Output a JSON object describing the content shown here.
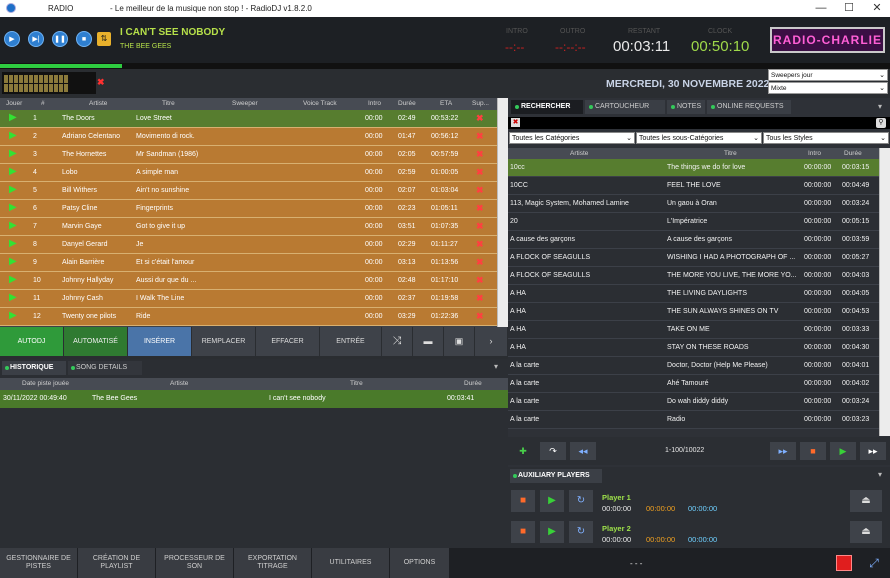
{
  "titlebar": {
    "app": "RADIO",
    "title": "- Le meilleur de la musique non stop ! - RadioDJ v1.8.2.0",
    "minimize": "—",
    "maximize": "☐",
    "close": "✕"
  },
  "nowplaying": {
    "title": "I CAN'T SEE NOBODY",
    "artist": "THE BEE GEES"
  },
  "clocks": {
    "intro_label": "INTRO",
    "intro_value": "--:--",
    "outro_label": "OUTRO",
    "outro_value": "--:--:--",
    "restant_label": "RESTANT",
    "restant_value": "00:03:11",
    "clock_label": "CLOCK",
    "clock_value": "00:50:10"
  },
  "logo": "RADIO-CHARLIE",
  "date": "MERCREDI, 30 NOVEMBRE 2022",
  "sweepers": {
    "value1": "Sweepers jour",
    "value2": "Mixte"
  },
  "playlist": {
    "headers": [
      "Jouer",
      "#",
      "Artiste",
      "Titre",
      "Sweeper",
      "Voice Track",
      "Intro",
      "Durée",
      "ETA",
      "Sup..."
    ],
    "rows": [
      {
        "num": "1",
        "artist": "The Doors",
        "title": "Love Street",
        "intro": "00:00",
        "dur": "02:49",
        "eta": "00:53:22"
      },
      {
        "num": "2",
        "artist": "Adriano Celentano",
        "title": "Movimento di rock.",
        "intro": "00:00",
        "dur": "01:47",
        "eta": "00:56:12"
      },
      {
        "num": "3",
        "artist": "The Hornettes",
        "title": "Mr Sandman (1986)",
        "intro": "00:00",
        "dur": "02:05",
        "eta": "00:57:59"
      },
      {
        "num": "4",
        "artist": "Lobo",
        "title": "A simple man",
        "intro": "00:00",
        "dur": "02:59",
        "eta": "01:00:05"
      },
      {
        "num": "5",
        "artist": "Bill Withers",
        "title": "Ain't no sunshine",
        "intro": "00:00",
        "dur": "02:07",
        "eta": "01:03:04"
      },
      {
        "num": "6",
        "artist": "Patsy Cline",
        "title": "Fingerprints",
        "intro": "00:00",
        "dur": "02:23",
        "eta": "01:05:11"
      },
      {
        "num": "7",
        "artist": "Marvin Gaye",
        "title": "Got to give it up",
        "intro": "00:00",
        "dur": "03:51",
        "eta": "01:07:35"
      },
      {
        "num": "8",
        "artist": "Danyel Gerard",
        "title": "Je",
        "intro": "00:00",
        "dur": "02:29",
        "eta": "01:11:27"
      },
      {
        "num": "9",
        "artist": "Alain Barrière",
        "title": "Et si c'était l'amour",
        "intro": "00:00",
        "dur": "03:13",
        "eta": "01:13:56"
      },
      {
        "num": "10",
        "artist": "Johnny Hallyday",
        "title": "Aussi dur que du ...",
        "intro": "00:00",
        "dur": "02:48",
        "eta": "01:17:10"
      },
      {
        "num": "11",
        "artist": "Johnny Cash",
        "title": "I Walk The Line",
        "intro": "00:00",
        "dur": "02:37",
        "eta": "01:19:58"
      },
      {
        "num": "12",
        "artist": "Twenty one pilots",
        "title": "Ride",
        "intro": "00:00",
        "dur": "03:29",
        "eta": "01:22:36"
      }
    ]
  },
  "toolbar": {
    "autodj": "AUTODJ",
    "automatise": "AUTOMATISÉ",
    "inserer": "INSÉRER",
    "remplacer": "REMPLACER",
    "effacer": "EFFACER",
    "entree": "ENTRÉE"
  },
  "history": {
    "tab1": "HISTORIQUE",
    "tab2": "SONG DETAILS",
    "headers": [
      "Date piste jouée",
      "Artiste",
      "Titre",
      "Durée"
    ],
    "row": {
      "date": "30/11/2022 00:49:40",
      "artist": "The Bee Gees",
      "title": "I can't see nobody",
      "dur": "00:03:41"
    }
  },
  "bottom": [
    "GESTIONNAIRE DE PISTES",
    "CRÉATION DE PLAYLIST",
    "PROCESSEUR DE SON",
    "EXPORTATION TITRAGE",
    "UTILITAIRES",
    "OPTIONS"
  ],
  "bottom_status": "- - -",
  "search": {
    "tabs": [
      "RECHERCHER",
      "CARTOUCHEUR",
      "NOTES",
      "ONLINE REQUESTS"
    ],
    "cat": "Toutes les Catégories",
    "subcat": "Toutes les sous-Catégories",
    "styles": "Tous les Styles",
    "headers": [
      "Artiste",
      "Titre",
      "Intro",
      "Durée"
    ],
    "rows": [
      {
        "artist": "10cc",
        "title": "The things we do for love",
        "intro": "00:00:00",
        "dur": "00:03:15"
      },
      {
        "artist": "10CC",
        "title": "FEEL THE LOVE",
        "intro": "00:00:00",
        "dur": "00:04:49"
      },
      {
        "artist": "113, Magic System, Mohamed Lamine",
        "title": "Un gaou à Oran",
        "intro": "00:00:00",
        "dur": "00:03:24"
      },
      {
        "artist": "20",
        "title": "L'Impératrice",
        "intro": "00:00:00",
        "dur": "00:05:15"
      },
      {
        "artist": "A cause des garçons",
        "title": "A cause des garçons",
        "intro": "00:00:00",
        "dur": "00:03:59"
      },
      {
        "artist": "A FLOCK OF SEAGULLS",
        "title": "WISHING I HAD A PHOTOGRAPH OF ...",
        "intro": "00:00:00",
        "dur": "00:05:27"
      },
      {
        "artist": "A FLOCK OF SEAGULLS",
        "title": "THE MORE YOU LIVE, THE MORE YO...",
        "intro": "00:00:00",
        "dur": "00:04:03"
      },
      {
        "artist": "A HA",
        "title": "THE LIVING DAYLIGHTS",
        "intro": "00:00:00",
        "dur": "00:04:05"
      },
      {
        "artist": "A HA",
        "title": "THE SUN ALWAYS SHINES ON TV",
        "intro": "00:00:00",
        "dur": "00:04:53"
      },
      {
        "artist": "A HA",
        "title": "TAKE ON ME",
        "intro": "00:00:00",
        "dur": "00:03:33"
      },
      {
        "artist": "A HA",
        "title": "STAY ON THESE ROADS",
        "intro": "00:00:00",
        "dur": "00:04:30"
      },
      {
        "artist": "A la carte",
        "title": "Doctor, Doctor (Help Me Please)",
        "intro": "00:00:00",
        "dur": "00:04:01"
      },
      {
        "artist": "A la carte",
        "title": "Ahé Tamouré",
        "intro": "00:00:00",
        "dur": "00:04:02"
      },
      {
        "artist": "A la carte",
        "title": "Do wah diddy diddy",
        "intro": "00:00:00",
        "dur": "00:03:24"
      },
      {
        "artist": "A la carte",
        "title": "Radio",
        "intro": "00:00:00",
        "dur": "00:03:23"
      }
    ],
    "page": "1-100/10022"
  },
  "aux": {
    "title": "AUXILIARY PLAYERS",
    "players": [
      {
        "name": "Player 1",
        "t1": "00:00:00",
        "t2": "00:00:00",
        "t3": "00:00:00"
      },
      {
        "name": "Player 2",
        "t1": "00:00:00",
        "t2": "00:00:00",
        "t3": "00:00:00"
      }
    ]
  },
  "colors": {
    "accent_green": "#2ecc40",
    "orange_row": "#b97a32",
    "green_row": "#577d2f",
    "blue_active": "#4a74a8"
  }
}
